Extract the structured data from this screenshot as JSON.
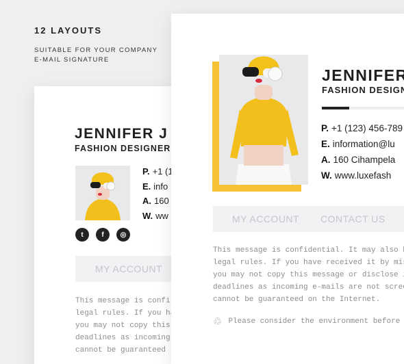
{
  "promo": {
    "title": "12 LAYOUTS",
    "subtitle_line1": "SUITABLE FOR YOUR COMPANY",
    "subtitle_line2": "E-MAIL SIGNATURE"
  },
  "back_card": {
    "name": "JENNIFER J",
    "role": "FASHION DESIGNER",
    "contacts": [
      {
        "key": "P.",
        "value": "+1 (1"
      },
      {
        "key": "E.",
        "value": "info"
      },
      {
        "key": "A.",
        "value": "160"
      },
      {
        "key": "W.",
        "value": "ww"
      }
    ],
    "social_icons": [
      "twitter-icon",
      "facebook-icon",
      "instagram-icon"
    ],
    "social_glyphs": [
      "t",
      "f",
      "◎"
    ],
    "nav": [
      "MY ACCOUNT"
    ],
    "disclaimer": [
      "This message is confi",
      "legal rules. If you ha",
      "you may not copy this",
      "deadlines as incoming",
      "cannot be guaranteed"
    ]
  },
  "front_card": {
    "name": "JENNIFER",
    "role": "FASHION DESIGN",
    "contacts": [
      {
        "key": "P.",
        "value": "+1 (123) 456-789"
      },
      {
        "key": "E.",
        "value": "information@lu"
      },
      {
        "key": "A.",
        "value": "160 Cihampela"
      },
      {
        "key": "W.",
        "value": "www.luxefash"
      }
    ],
    "nav": [
      "MY ACCOUNT",
      "CONTACT US"
    ],
    "disclaimer": [
      "This message is confidential. It may also b",
      "legal rules. If you have received it by mis",
      "you may not copy this message or disclose i",
      "deadlines as incoming e-mails are not scree",
      "cannot be guaranteed on the Internet."
    ],
    "eco_note": "Please consider the environment before"
  },
  "colors": {
    "accent_yellow": "#f7c137",
    "dark": "#222222",
    "nav_bg": "#f2f2f4",
    "nav_text": "#c6c6ca"
  }
}
